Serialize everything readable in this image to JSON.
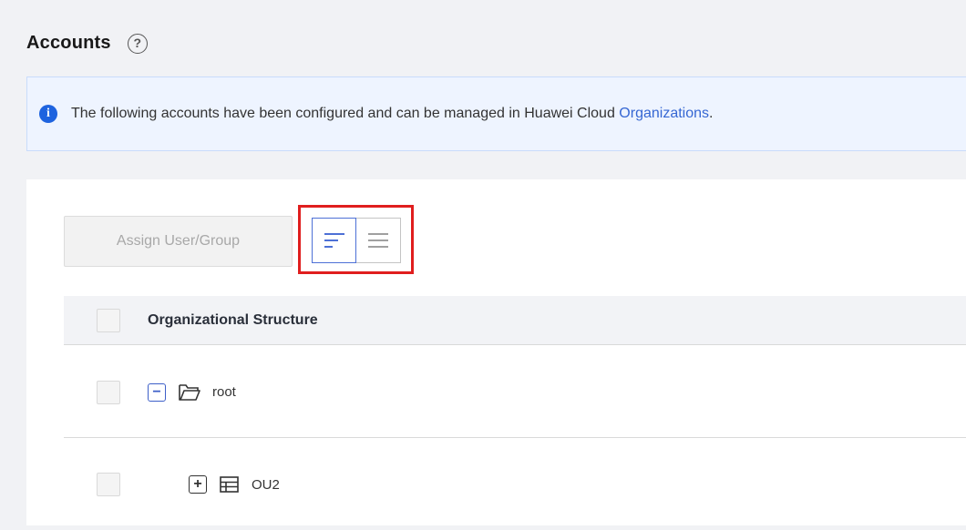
{
  "header": {
    "title": "Accounts",
    "help_glyph": "?"
  },
  "banner": {
    "icon_glyph": "i",
    "text": "The following accounts have been configured and can be managed in Huawei Cloud ",
    "link": "Organizations",
    "suffix": "."
  },
  "toolbar": {
    "assign_label": "Assign User/Group",
    "views": [
      "tree-view-icon",
      "list-view-icon"
    ],
    "active_view": "tree"
  },
  "table": {
    "column": "Organizational Structure",
    "rows": [
      {
        "label": "root",
        "toggle": "−",
        "icon": "folder-icon",
        "expanded": true
      },
      {
        "label": "OU2",
        "toggle": "+",
        "icon": "ou-table-icon",
        "expanded": false
      }
    ]
  },
  "colors": {
    "accent": "#3d5fc8",
    "highlight": "#e01e1e",
    "banner_bg": "#eef4ff"
  }
}
